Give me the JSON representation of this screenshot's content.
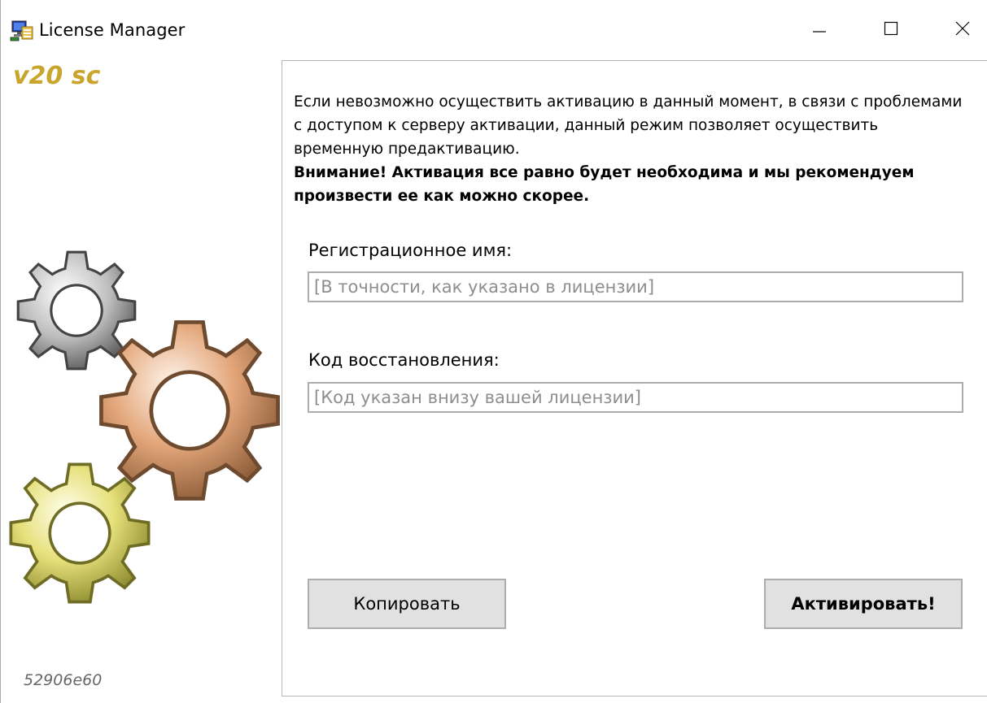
{
  "window": {
    "title": "License Manager",
    "controls": {
      "minimize": "minimize-icon",
      "maximize": "maximize-icon",
      "close": "close-icon"
    }
  },
  "sidebar": {
    "version": "v20 sc",
    "serial": "52906e60"
  },
  "main": {
    "notice": "Если невозможно осуществить активацию в данный момент, в связи с проблемами с доступом к серверу активации, данный режим позволяет осуществить временную предактивацию.",
    "warning": "Внимание! Активация все равно будет необходима и мы рекомендуем произвести ее как можно скорее.",
    "name_field": {
      "label": "Регистрационное имя:",
      "value": "",
      "placeholder": "[В точности, как указано в лицензии]"
    },
    "code_field": {
      "label": "Код восстановления:",
      "value": "",
      "placeholder": "[Код указан внизу вашей лицензии]"
    },
    "buttons": {
      "copy": "Копировать",
      "activate": "Активировать!"
    }
  },
  "colors": {
    "version_text": "#c9a52e",
    "button_bg": "#e1e1e1",
    "border": "#adadad"
  }
}
